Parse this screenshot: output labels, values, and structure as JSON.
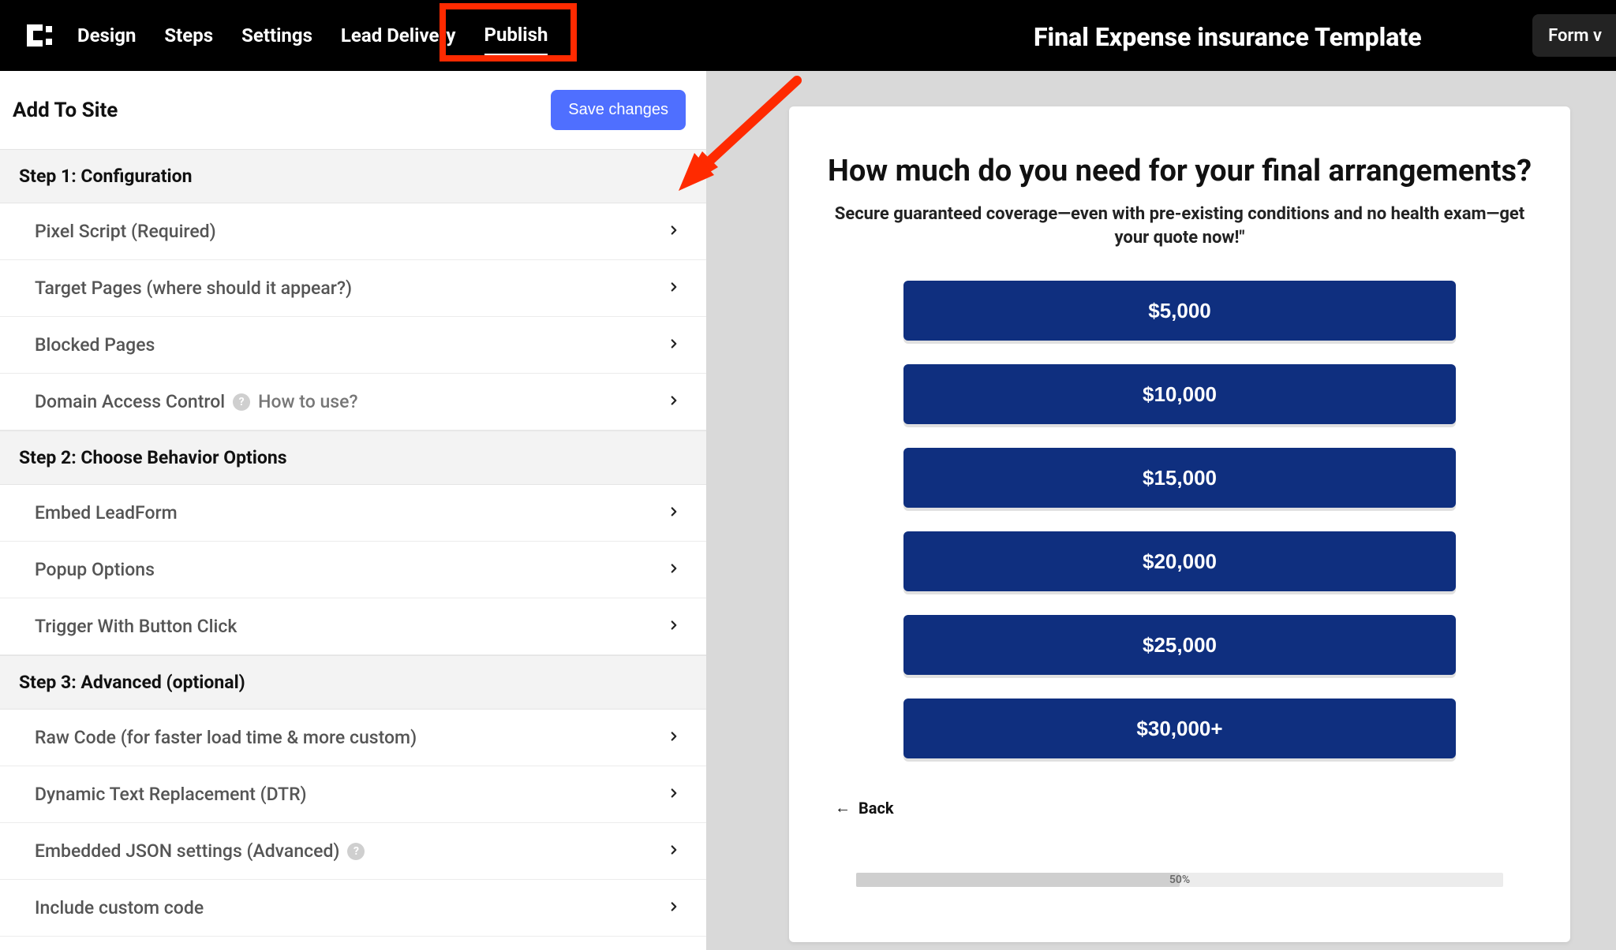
{
  "topbar": {
    "nav": [
      "Design",
      "Steps",
      "Settings",
      "Lead Delivery",
      "Publish"
    ],
    "active_index": 4,
    "app_title": "Final Expense insurance Template",
    "right_button": "Form v"
  },
  "sidebar": {
    "title": "Add To Site",
    "save_label": "Save changes",
    "steps": [
      {
        "header": "Step 1: Configuration",
        "rows": [
          {
            "label": "Pixel Script (Required)",
            "info": false,
            "hint": null
          },
          {
            "label": "Target Pages (where should it appear?)",
            "info": false,
            "hint": null
          },
          {
            "label": "Blocked Pages",
            "info": false,
            "hint": null
          },
          {
            "label": "Domain Access Control",
            "info": true,
            "hint": "How to use?"
          }
        ]
      },
      {
        "header": "Step 2: Choose Behavior Options",
        "rows": [
          {
            "label": "Embed LeadForm",
            "info": false,
            "hint": null
          },
          {
            "label": "Popup Options",
            "info": false,
            "hint": null
          },
          {
            "label": "Trigger With Button Click",
            "info": false,
            "hint": null
          }
        ]
      },
      {
        "header": "Step 3: Advanced (optional)",
        "rows": [
          {
            "label": "Raw Code (for faster load time & more custom)",
            "info": false,
            "hint": null
          },
          {
            "label": "Dynamic Text Replacement (DTR)",
            "info": false,
            "hint": null
          },
          {
            "label": "Embedded JSON settings (Advanced)",
            "info": true,
            "hint": null
          },
          {
            "label": "Include custom code",
            "info": false,
            "hint": null
          }
        ]
      }
    ]
  },
  "preview": {
    "question_title": "How much do you need for your final arrangements?",
    "question_sub": "Secure guaranteed coverage—even with pre-existing conditions and no health exam—get your quote now!\"",
    "options": [
      "$5,000",
      "$10,000",
      "$15,000",
      "$20,000",
      "$25,000",
      "$30,000+"
    ],
    "back_label": "Back",
    "progress_percent": 50,
    "progress_label": "50%"
  },
  "colors": {
    "option_button": "#0f2f7f",
    "save_button": "#4f6fff",
    "annotation": "#ff2a00"
  }
}
